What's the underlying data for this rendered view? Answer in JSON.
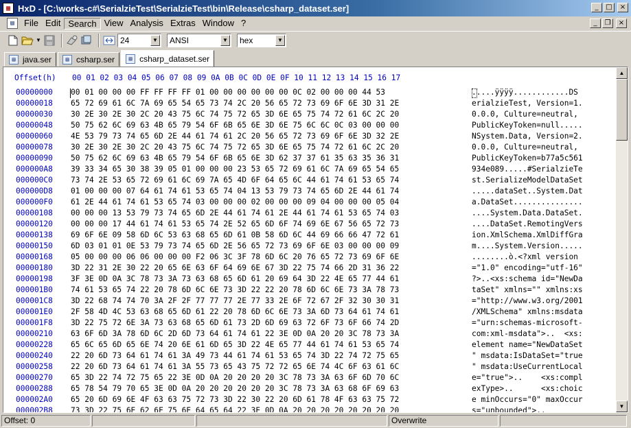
{
  "window": {
    "app_icon": "hex-app-icon",
    "title": "HxD - [C:\\works-c#\\SerialzieTest\\SerialzieTest\\bin\\Release\\csharp_dataset.ser]",
    "min_symbol": "_",
    "max_symbol": "□",
    "close_symbol": "×",
    "restore_symbol": "❐"
  },
  "menu": {
    "items": [
      "File",
      "Edit",
      "Search",
      "View",
      "Analysis",
      "Extras",
      "Window",
      "?"
    ],
    "active": "Search"
  },
  "toolbar": {
    "icons": [
      "new-file-icon",
      "open-file-icon",
      "save-icon",
      "settings-icon",
      "ram-icon",
      "bytes-per-row-icon"
    ],
    "bytes_per_row": "24",
    "charset": "ANSI",
    "offset_base": "hex"
  },
  "tabs": [
    {
      "label": "java.ser",
      "active": false
    },
    {
      "label": "csharp.ser",
      "active": false
    },
    {
      "label": "csharp_dataset.ser",
      "active": true
    }
  ],
  "editor": {
    "offset_header": "Offset(h)",
    "column_header": "00 01 02 03 04 05 06 07 08 09 0A 0B 0C 0D 0E 0F 10 11 12 13 14 15 16 17",
    "rows": [
      {
        "off": "00000000",
        "hex": "00 01 00 00 00 FF FF FF FF 01 00 00 00 00 00 00 0C 02 00 00 00 44 53",
        "txt": ".....ÿÿÿÿ............DS"
      },
      {
        "off": "00000018",
        "hex": "65 72 69 61 6C 7A 69 65 54 65 73 74 2C 20 56 65 72 73 69 6F 6E 3D 31 2E",
        "txt": "erialzieTest, Version=1."
      },
      {
        "off": "00000030",
        "hex": "30 2E 30 2E 30 2C 20 43 75 6C 74 75 72 65 3D 6E 65 75 74 72 61 6C 2C 20",
        "txt": "0.0.0, Culture=neutral, "
      },
      {
        "off": "00000048",
        "hex": "50 75 62 6C 69 63 4B 65 79 54 6F 6B 65 6E 3D 6E 75 6C 6C 0C 03 00 00 00",
        "txt": "PublicKeyToken=null....."
      },
      {
        "off": "00000060",
        "hex": "4E 53 79 73 74 65 6D 2E 44 61 74 61 2C 20 56 65 72 73 69 6F 6E 3D 32 2E",
        "txt": "NSystem.Data, Version=2."
      },
      {
        "off": "00000078",
        "hex": "30 2E 30 2E 30 2C 20 43 75 6C 74 75 72 65 3D 6E 65 75 74 72 61 6C 2C 20",
        "txt": "0.0.0, Culture=neutral, "
      },
      {
        "off": "00000090",
        "hex": "50 75 62 6C 69 63 4B 65 79 54 6F 6B 65 6E 3D 62 37 37 61 35 63 35 36 31",
        "txt": "PublicKeyToken=b77a5c561"
      },
      {
        "off": "000000A8",
        "hex": "39 33 34 65 30 38 39 05 01 00 00 00 23 53 65 72 69 61 6C 7A 69 65 54 65",
        "txt": "934e089.....#SerialzieTe"
      },
      {
        "off": "000000C0",
        "hex": "73 74 2E 53 65 72 69 61 6C 69 7A 65 4D 6F 64 65 6C 44 61 74 61 53 65 74",
        "txt": "st.SerializeModelDataSet"
      },
      {
        "off": "000000D8",
        "hex": "01 00 00 00 07 64 61 74 61 53 65 74 04 13 53 79 73 74 65 6D 2E 44 61 74",
        "txt": ".....dataSet..System.Dat"
      },
      {
        "off": "000000F0",
        "hex": "61 2E 44 61 74 61 53 65 74 03 00 00 00 02 00 00 00 09 04 00 00 00 05 04",
        "txt": "a.DataSet..............."
      },
      {
        "off": "00000108",
        "hex": "00 00 00 13 53 79 73 74 65 6D 2E 44 61 74 61 2E 44 61 74 61 53 65 74 03",
        "txt": "....System.Data.DataSet."
      },
      {
        "off": "00000120",
        "hex": "00 00 00 17 44 61 74 61 53 65 74 2E 52 65 6D 6F 74 69 6E 67 56 65 72 73",
        "txt": "....DataSet.RemotingVers"
      },
      {
        "off": "00000138",
        "hex": "69 6F 6E 09 58 6D 6C 53 63 68 65 6D 61 0B 58 6D 6C 44 69 66 66 47 72 61",
        "txt": "ion.XmlSchema.XmlDiffGra"
      },
      {
        "off": "00000150",
        "hex": "6D 03 01 01 0E 53 79 73 74 65 6D 2E 56 65 72 73 69 6F 6E 03 00 00 00 09",
        "txt": "m....System.Version....."
      },
      {
        "off": "00000168",
        "hex": "05 00 00 00 06 06 00 00 00 F2 06 3C 3F 78 6D 6C 20 76 65 72 73 69 6F 6E",
        "txt": "........ò.<?xml version"
      },
      {
        "off": "00000180",
        "hex": "3D 22 31 2E 30 22 20 65 6E 63 6F 64 69 6E 67 3D 22 75 74 66 2D 31 36 22",
        "txt": "=\"1.0\" encoding=\"utf-16\""
      },
      {
        "off": "00000198",
        "hex": "3F 3E 0D 0A 3C 78 73 3A 73 63 68 65 6D 61 20 69 64 3D 22 4E 65 77 44 61",
        "txt": "?>..<xs:schema id=\"NewDa"
      },
      {
        "off": "000001B0",
        "hex": "74 61 53 65 74 22 20 78 6D 6C 6E 73 3D 22 22 20 78 6D 6C 6E 73 3A 78 73",
        "txt": "taSet\" xmlns=\"\" xmlns:xs"
      },
      {
        "off": "000001C8",
        "hex": "3D 22 68 74 74 70 3A 2F 2F 77 77 77 2E 77 33 2E 6F 72 67 2F 32 30 30 31",
        "txt": "=\"http://www.w3.org/2001"
      },
      {
        "off": "000001E0",
        "hex": "2F 58 4D 4C 53 63 68 65 6D 61 22 20 78 6D 6C 6E 73 3A 6D 73 64 61 74 61",
        "txt": "/XMLSchema\" xmlns:msdata"
      },
      {
        "off": "000001F8",
        "hex": "3D 22 75 72 6E 3A 73 63 68 65 6D 61 73 2D 6D 69 63 72 6F 73 6F 66 74 2D",
        "txt": "=\"urn:schemas-microsoft-"
      },
      {
        "off": "00000210",
        "hex": "63 6F 6D 3A 78 6D 6C 2D 6D 73 64 61 74 61 22 3E 0D 0A 20 20 3C 78 73 3A",
        "txt": "com:xml-msdata\">..  <xs:"
      },
      {
        "off": "00000228",
        "hex": "65 6C 65 6D 65 6E 74 20 6E 61 6D 65 3D 22 4E 65 77 44 61 74 61 53 65 74",
        "txt": "element name=\"NewDataSet"
      },
      {
        "off": "00000240",
        "hex": "22 20 6D 73 64 61 74 61 3A 49 73 44 61 74 61 53 65 74 3D 22 74 72 75 65",
        "txt": "\" msdata:IsDataSet=\"true"
      },
      {
        "off": "00000258",
        "hex": "22 20 6D 73 64 61 74 61 3A 55 73 65 43 75 72 72 65 6E 74 4C 6F 63 61 6C",
        "txt": "\" msdata:UseCurrentLocal"
      },
      {
        "off": "00000270",
        "hex": "65 3D 22 74 72 75 65 22 3E 0D 0A 20 20 20 20 3C 78 73 3A 63 6F 6D 70 6C",
        "txt": "e=\"true\">..    <xs:compl"
      },
      {
        "off": "00000288",
        "hex": "65 78 54 79 70 65 3E 0D 0A 20 20 20 20 20 20 3C 78 73 3A 63 68 6F 69 63",
        "txt": "exType>..      <xs:choic"
      },
      {
        "off": "000002A0",
        "hex": "65 20 6D 69 6E 4F 63 63 75 72 73 3D 22 30 22 20 6D 61 78 4F 63 63 75 72",
        "txt": "e minOccurs=\"0\" maxOccur"
      },
      {
        "off": "000002B8",
        "hex": "73 3D 22 75 6E 62 6F 75 6E 64 65 64 22 3E 0D 0A 20 20 20 20 20 20 20 20",
        "txt": "s=\"unbounded\">.."
      }
    ]
  },
  "status": {
    "offset": "Offset: 0",
    "mode": "Overwrite"
  }
}
